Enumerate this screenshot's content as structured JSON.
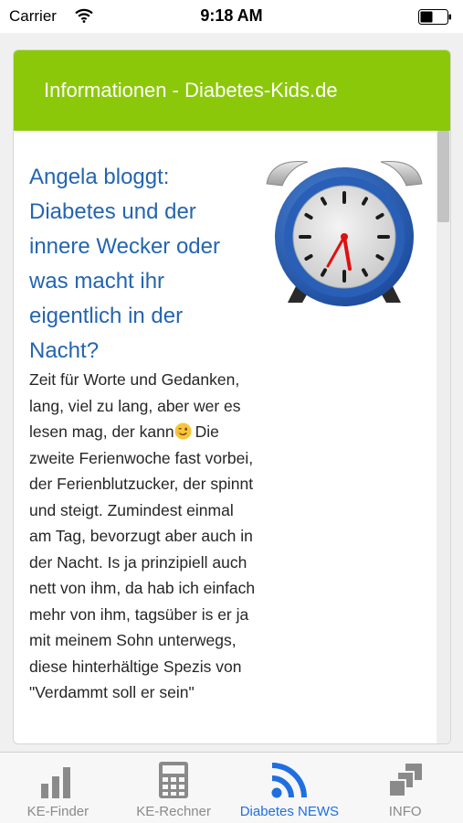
{
  "status_bar": {
    "carrier": "Carrier",
    "time": "9:18 AM"
  },
  "card": {
    "header_title": "Informationen - Diabetes-Kids.de",
    "article": {
      "title": "Angela bloggt: Diabetes und der innere Wecker oder was macht ihr eigentlich in der Nacht?",
      "text_before_emoji": "Zeit für Worte und Gedanken, lang, viel zu lang, aber wer es lesen mag, der kann",
      "text_after_emoji": "Die zweite Ferienwoche fast vorbei, der Ferienblutzucker, der spinnt und steigt. Zumindest einmal am Tag, bevorzugt aber auch in der Nacht. Is ja prinzipiell auch nett von ihm, da hab ich einfach mehr von ihm, tagsüber is er ja mit meinem Sohn unterwegs, diese hinterhältige Spezis von \"Verdammt soll er sein\"",
      "image": "alarm-clock-image"
    }
  },
  "tabs": [
    {
      "label": "KE-Finder",
      "icon": "bar-chart-icon",
      "active": false
    },
    {
      "label": "KE-Rechner",
      "icon": "calculator-icon",
      "active": false
    },
    {
      "label": "Diabetes NEWS",
      "icon": "rss-feed-icon",
      "active": true
    },
    {
      "label": "INFO",
      "icon": "stack-icon",
      "active": false
    }
  ],
  "colors": {
    "header": "#8cc80a",
    "link": "#2465b0",
    "tab_active": "#1f6fe0",
    "tab_inactive": "#8a8a8a"
  }
}
